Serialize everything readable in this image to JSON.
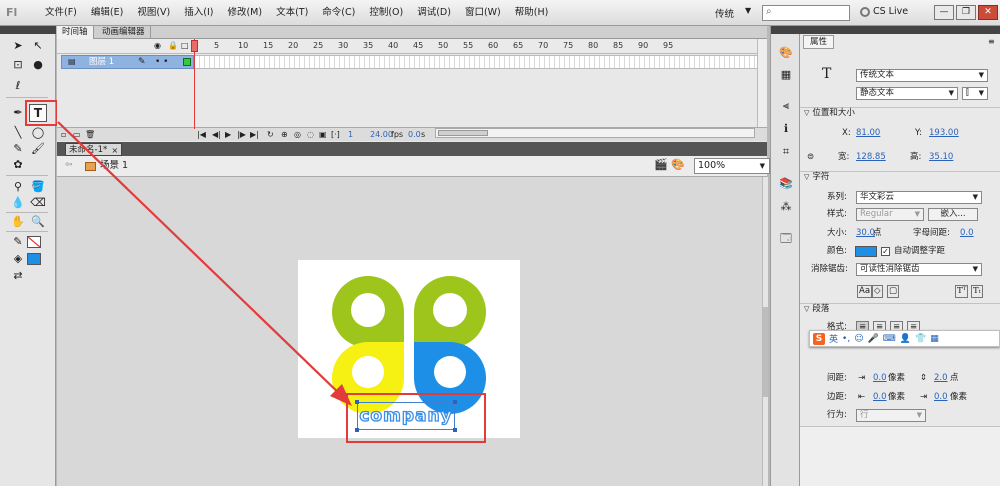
{
  "menubar": {
    "logo": "Fl",
    "items": [
      "文件(F)",
      "编辑(E)",
      "视图(V)",
      "插入(I)",
      "修改(M)",
      "文本(T)",
      "命令(C)",
      "控制(O)",
      "调试(D)",
      "窗口(W)",
      "帮助(H)"
    ],
    "workspace": "传统",
    "cs_live": "CS Live"
  },
  "timeline": {
    "tabs": [
      "时间轴",
      "动画编辑器"
    ],
    "frame_numbers": [
      "5",
      "10",
      "15",
      "20",
      "25",
      "30",
      "35",
      "40",
      "45",
      "50",
      "55",
      "60",
      "65",
      "70",
      "75",
      "80",
      "85",
      "90",
      "95"
    ],
    "layer_name": "图层 1",
    "current_frame": "1",
    "fps": "24.00",
    "fps_unit": "fps",
    "time": "0.0",
    "time_unit": "s"
  },
  "document": {
    "tab_title": "未命名-1*",
    "scene_label": "场景 1",
    "zoom": "100%",
    "stage_text": "company"
  },
  "properties": {
    "tab_label": "属性",
    "text_type": "传统文本",
    "text_subtype": "静态文本",
    "position_section": "位置和大小",
    "x_label": "X:",
    "x_value": "81.00",
    "y_label": "Y:",
    "y_value": "193.00",
    "w_label": "宽:",
    "w_value": "128.85",
    "h_label": "高:",
    "h_value": "35.10",
    "char_section": "字符",
    "family_label": "系列:",
    "family_value": "华文彩云",
    "style_label": "样式:",
    "style_value": "Regular",
    "embed_button": "嵌入...",
    "size_label": "大小:",
    "size_value": "30.0",
    "size_unit": "点",
    "spacing_label": "字母间距:",
    "spacing_value": "0.0",
    "color_label": "颜色:",
    "auto_kern_label": "自动调整字距",
    "antialias_label": "消除锯齿:",
    "antialias_value": "可读性消除锯齿",
    "para_section": "段落",
    "format_label": "格式:",
    "line_spacing_label": "间距:",
    "line_spacing_value": "0.0",
    "line_spacing_unit": "像素",
    "line_spacing_value2": "2.0",
    "line_spacing_unit2": "点",
    "margin_label": "边距:",
    "margin_value": "0.0",
    "margin_unit": "像素",
    "margin_value2": "0.0",
    "margin_unit2": "像素",
    "behavior_label": "行为:",
    "behavior_value": "行"
  },
  "ime": {
    "logo": "S",
    "mode": "英"
  },
  "colors": {
    "logo_green": "#9dc51c",
    "logo_yellow": "#f7f013",
    "logo_blue": "#1e8fe6",
    "annotation_red": "#e23b3b"
  }
}
